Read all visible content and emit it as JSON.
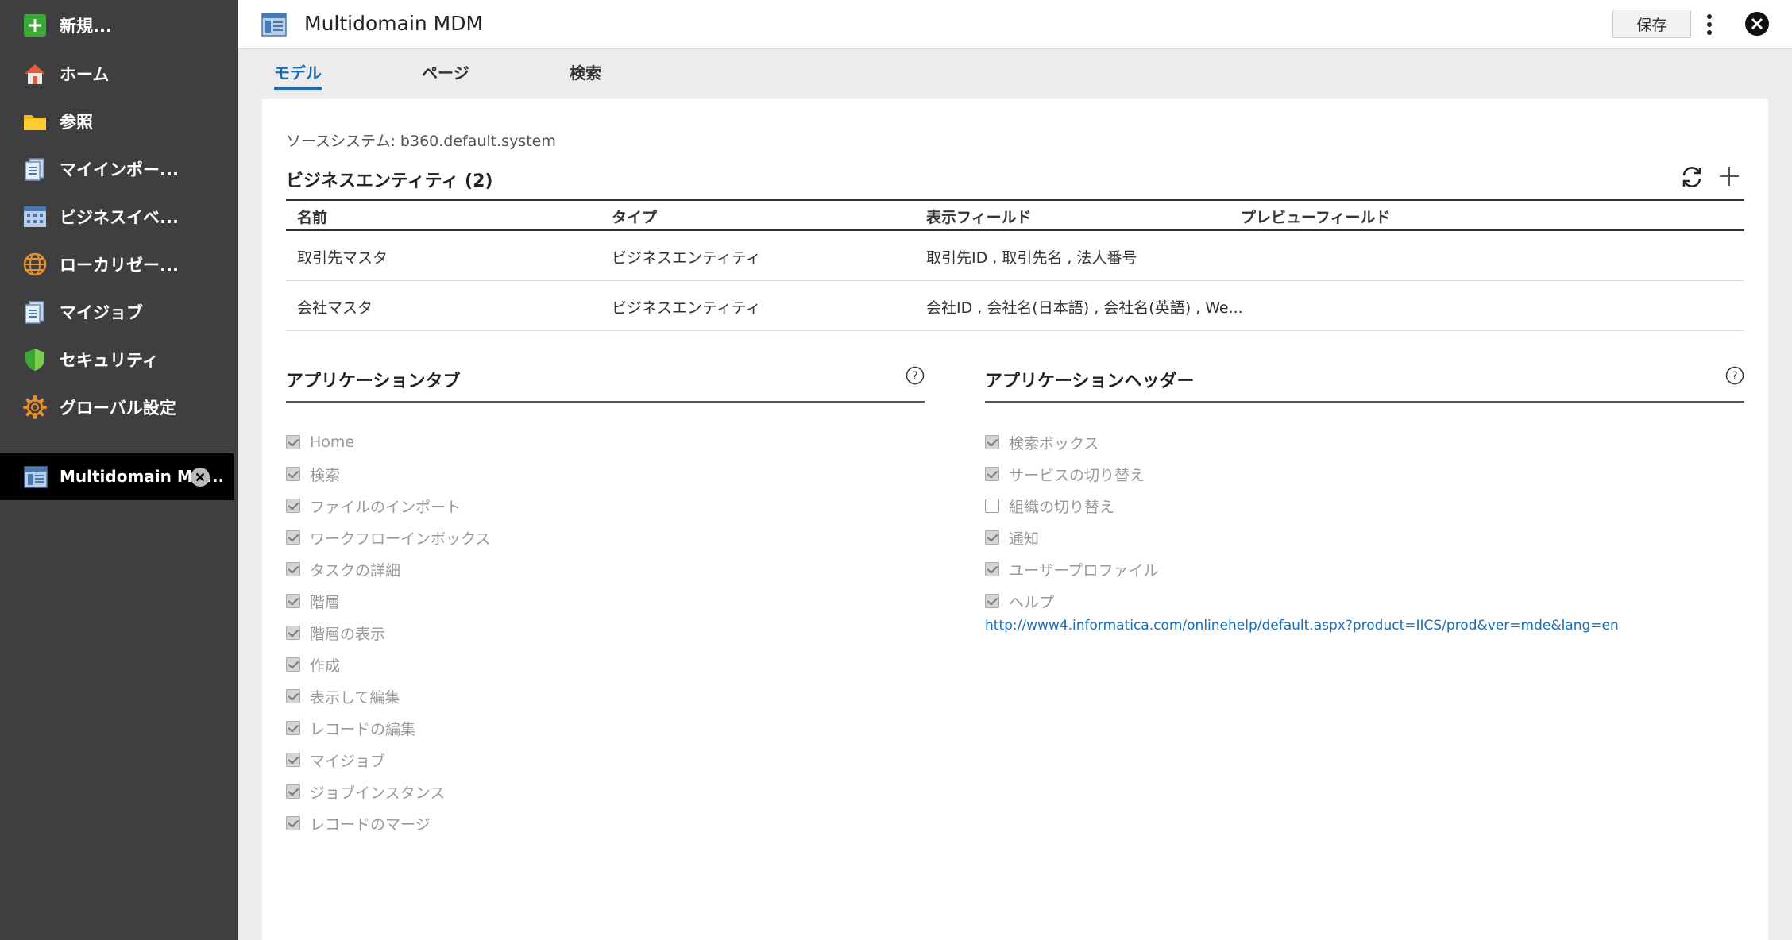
{
  "sidebar": {
    "items": [
      {
        "label": "新規...",
        "icon": "plus-icon"
      },
      {
        "label": "ホーム",
        "icon": "home-icon"
      },
      {
        "label": "参照",
        "icon": "folder-icon"
      },
      {
        "label": "マイインポー...",
        "icon": "import-icon"
      },
      {
        "label": "ビジネスイベ...",
        "icon": "business-event-icon"
      },
      {
        "label": "ローカリゼー...",
        "icon": "globe-icon"
      },
      {
        "label": "マイジョブ",
        "icon": "jobs-icon"
      },
      {
        "label": "セキュリティ",
        "icon": "shield-icon"
      },
      {
        "label": "グローバル設定",
        "icon": "gear-icon"
      }
    ],
    "open_item": {
      "label": "Multidomain MD...",
      "icon": "app-icon"
    }
  },
  "header": {
    "title": "Multidomain MDM",
    "save_label": "保存"
  },
  "tabs": [
    {
      "label": "モデル",
      "active": true
    },
    {
      "label": "ページ",
      "active": false
    },
    {
      "label": "検索",
      "active": false
    }
  ],
  "main": {
    "source_system": "ソースシステム:  b360.default.system",
    "entities_title": "ビジネスエンティティ (2)",
    "columns": [
      "名前",
      "タイプ",
      "表示フィールド",
      "プレビューフィールド"
    ],
    "rows": [
      [
        "取引先マスタ",
        "ビジネスエンティティ",
        "取引先ID , 取引先名 , 法人番号",
        ""
      ],
      [
        "会社マスタ",
        "ビジネスエンティティ",
        "会社ID , 会社名(日本語) , 会社名(英語) , We...",
        ""
      ]
    ],
    "app_tabs_title": "アプリケーションタブ",
    "app_tabs": [
      {
        "label": "Home",
        "checked": true
      },
      {
        "label": "検索",
        "checked": true
      },
      {
        "label": "ファイルのインポート",
        "checked": true
      },
      {
        "label": "ワークフローインボックス",
        "checked": true
      },
      {
        "label": "タスクの詳細",
        "checked": true
      },
      {
        "label": "階層",
        "checked": true
      },
      {
        "label": "階層の表示",
        "checked": true
      },
      {
        "label": "作成",
        "checked": true
      },
      {
        "label": "表示して編集",
        "checked": true
      },
      {
        "label": "レコードの編集",
        "checked": true
      },
      {
        "label": "マイジョブ",
        "checked": true
      },
      {
        "label": "ジョブインスタンス",
        "checked": true
      },
      {
        "label": "レコードのマージ",
        "checked": true
      }
    ],
    "app_header_title": "アプリケーションヘッダー",
    "app_header": [
      {
        "label": "検索ボックス",
        "checked": true
      },
      {
        "label": "サービスの切り替え",
        "checked": true
      },
      {
        "label": "組織の切り替え",
        "checked": false
      },
      {
        "label": "通知",
        "checked": true
      },
      {
        "label": "ユーザープロファイル",
        "checked": true
      },
      {
        "label": "ヘルプ",
        "checked": true
      }
    ],
    "help_url": "http://www4.informatica.com/onlinehelp/default.aspx?product=IICS/prod&ver=mde&lang=en"
  },
  "colors": {
    "sidebar_bg": "#3f3f41",
    "accent": "#1a6eb8",
    "open_item_bg": "#000000"
  }
}
